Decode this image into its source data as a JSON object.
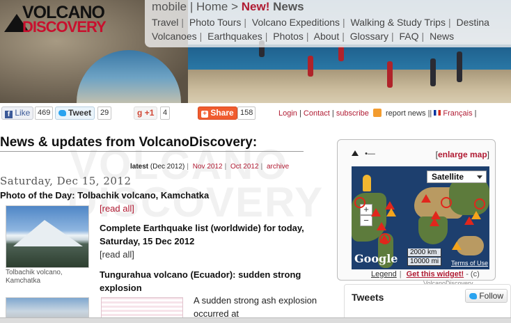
{
  "header": {
    "logo_line1": "VOLCANO",
    "logo_line2": "DISCOVERY",
    "crumbs": {
      "mobile": "mobile",
      "sep1": "|",
      "home": "Home",
      "arrow": ">",
      "new": "New!",
      "news": "News"
    },
    "nav_row1": [
      "Travel",
      "Photo Tours",
      "Volcano Expeditions",
      "Walking & Study Trips",
      "Destina"
    ],
    "nav_row2": [
      "Volcanoes",
      "Earthquakes",
      "Photos",
      "About",
      "Glossary",
      "FAQ",
      "News"
    ]
  },
  "social": {
    "fb_label": "Like",
    "fb_count": "469",
    "tw_label": "Tweet",
    "tw_count": "29",
    "gp_label": "+1",
    "gp_count": "4",
    "share_label": "Share",
    "share_count": "158",
    "links": {
      "login": "Login",
      "contact": "Contact",
      "subscribe": "subscribe",
      "report": "report news",
      "sep": "||",
      "lang": "Français",
      "trail": "|"
    }
  },
  "watermark": {
    "line1": "VOLCANO",
    "line2": "DISCOVERY"
  },
  "main": {
    "title": "News & updates from VolcanoDiscovery:",
    "archive": {
      "latest": "latest",
      "latest_month": "(Dec 2012)",
      "nov": "Nov 2012",
      "oct": "Oct 2012",
      "archive": "archive"
    },
    "date": "Saturday, Dec 15, 2012",
    "potd": "Photo of the Day: Tolbachik volcano, Kamchatka",
    "read_all": "[read all]",
    "thumb1_caption": "Tolbachik volcano, Kamchatka",
    "eq_title": "Complete Earthquake list (worldwide) for today, Saturday, 15 Dec 2012",
    "tung_title": "Tungurahua volcano (Ecuador): sudden strong explosion",
    "tung_text": "A sudden strong ash explosion occurred at"
  },
  "map_widget": {
    "enlarge_open": "[",
    "enlarge": "enlarge map",
    "enlarge_close": "]",
    "map_type": "Satellite",
    "zoom_in": "+",
    "zoom_out": "−",
    "google": "Google",
    "scale_km": "2000 km",
    "scale_mi": "10000 mi",
    "terms": "Terms of Use",
    "legend": "Legend",
    "sep": "|",
    "get_widget": "Get this widget!",
    "copyright": "- (c)",
    "credit": "VolcanoDiscovery"
  },
  "tweets": {
    "title": "Tweets",
    "follow": "Follow"
  },
  "colors": {
    "accent": "#b01a32",
    "share": "#f05c2f",
    "twitter": "#2aa3ef"
  },
  "icons": [
    "facebook-icon",
    "twitter-icon",
    "gplus-icon",
    "share-icon",
    "rss-icon",
    "flag-fr-icon",
    "volcano-icon",
    "pegman-icon"
  ]
}
